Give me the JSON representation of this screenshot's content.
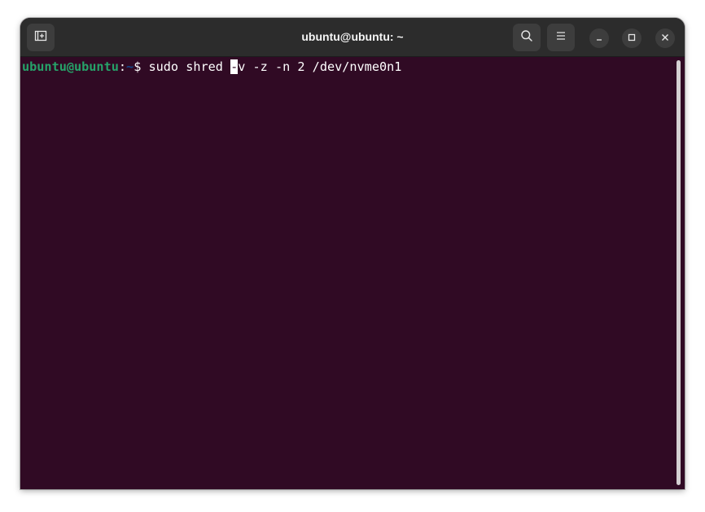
{
  "window": {
    "title": "ubuntu@ubuntu: ~"
  },
  "toolbar": {
    "new_tab_icon": "new-tab-icon",
    "search_icon": "search-icon",
    "menu_icon": "hamburger-menu-icon"
  },
  "window_controls": {
    "minimize_icon": "minimize-icon",
    "maximize_icon": "maximize-icon",
    "close_icon": "close-icon"
  },
  "terminal": {
    "prompt_user": "ubuntu@ubuntu",
    "prompt_colon": ":",
    "prompt_path": "~",
    "prompt_dollar": "$ ",
    "command_before_cursor": "sudo shred ",
    "cursor_char": "-",
    "command_after_cursor": "v -z -n 2 /dev/nvme0n1"
  },
  "colors": {
    "terminal_background": "#300a24",
    "titlebar_background": "#2c2c2c",
    "prompt_user": "#26a269",
    "prompt_path": "#12488b",
    "text": "#ffffff"
  }
}
